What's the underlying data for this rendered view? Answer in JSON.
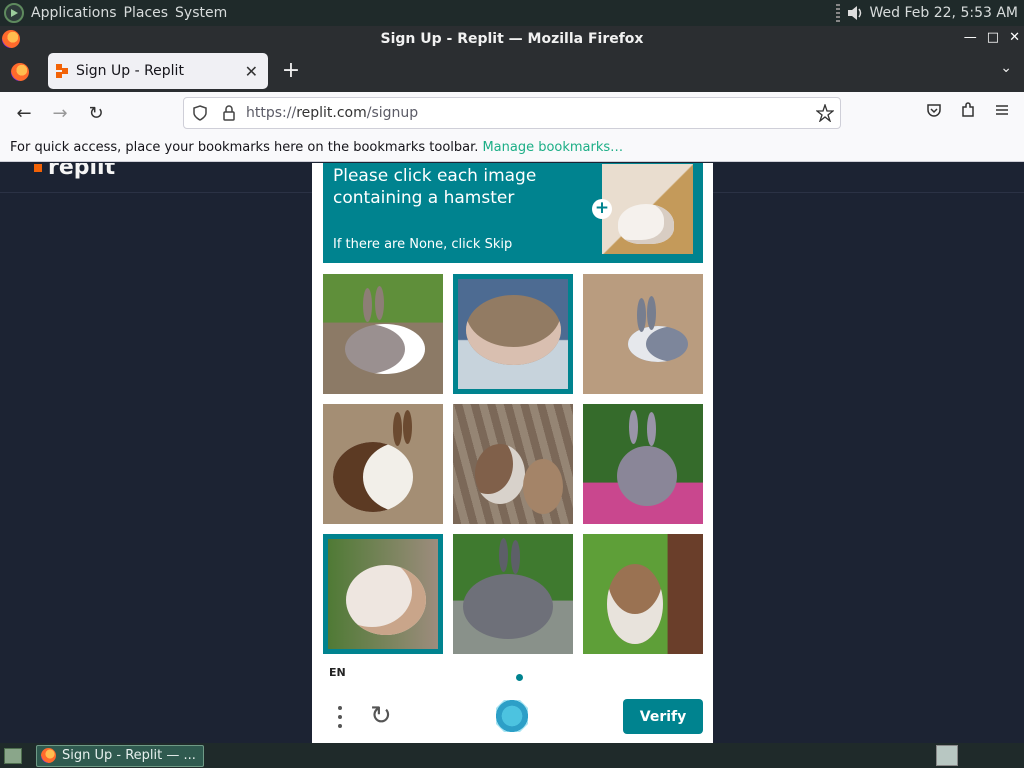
{
  "system_panel": {
    "menus": [
      "Applications",
      "Places",
      "System"
    ],
    "clock": "Wed Feb 22,  5:53 AM"
  },
  "window": {
    "title": "Sign Up - Replit — Mozilla Firefox"
  },
  "tab": {
    "label": "Sign Up - Replit",
    "close": "✕",
    "new_tab": "+"
  },
  "navbar": {
    "back": "←",
    "forward": "→",
    "reload": "↻",
    "url_prefix": "https://",
    "url_host": "replit.com",
    "url_path": "/signup"
  },
  "bookmarks_bar": {
    "message": "For quick access, place your bookmarks here on the bookmarks toolbar.",
    "link": "Manage bookmarks…"
  },
  "page": {
    "logo_text": "replit"
  },
  "captcha": {
    "prompt_title": "Please click each image containing a hamster",
    "prompt_hint": "If there are None, click Skip",
    "language": "EN",
    "verify_label": "Verify",
    "tiles": [
      {
        "subject": "rabbit",
        "selected": false
      },
      {
        "subject": "hamster",
        "selected": true
      },
      {
        "subject": "rabbit",
        "selected": false
      },
      {
        "subject": "rabbit",
        "selected": false
      },
      {
        "subject": "squirrel",
        "selected": false
      },
      {
        "subject": "rabbit",
        "selected": false
      },
      {
        "subject": "hamster",
        "selected": true
      },
      {
        "subject": "rabbit",
        "selected": false
      },
      {
        "subject": "squirrel",
        "selected": false
      }
    ]
  },
  "taskbar": {
    "task_label": "Sign Up - Replit — ..."
  },
  "colors": {
    "captcha_teal": "#00838f",
    "replit_orange": "#f26207",
    "page_bg": "#1c2333"
  }
}
